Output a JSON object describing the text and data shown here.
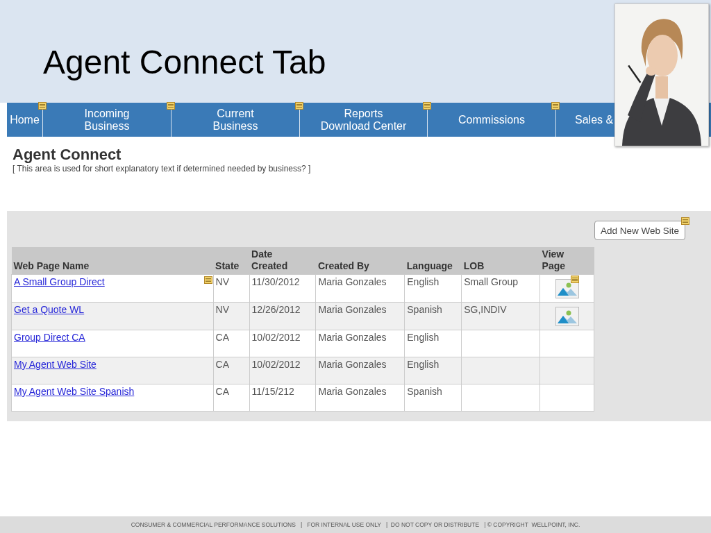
{
  "slide": {
    "title": "Agent Connect Tab"
  },
  "nav": [
    {
      "label": "Home",
      "note": true
    },
    {
      "label": "Incoming\nBusiness",
      "note": true
    },
    {
      "label": "Current\nBusiness",
      "note": true
    },
    {
      "label": "Reports\nDownload Center",
      "note": true
    },
    {
      "label": "Commissions",
      "note": true
    },
    {
      "label": "Sales &",
      "note": false
    }
  ],
  "page": {
    "heading": "Agent Connect",
    "description": "[ This area is used for short explanatory text if determined needed by business? ]"
  },
  "add_button": {
    "label": "Add New Web Site",
    "note": true
  },
  "table": {
    "columns": [
      "Web Page Name",
      "State",
      "Date\nCreated",
      "Created By",
      "Language",
      "LOB",
      "View\nPage"
    ],
    "rows": [
      {
        "name": "A Small Group Direct",
        "name_note": true,
        "state": "NV",
        "date": "11/30/2012",
        "created_by": "Maria Gonzales",
        "language": "English",
        "lob": "Small Group",
        "view_icon": true,
        "view_note": true
      },
      {
        "name": "Get a Quote WL",
        "name_note": false,
        "state": "NV",
        "date": "12/26/2012",
        "created_by": "Maria Gonzales",
        "language": "Spanish",
        "lob": "SG,INDIV",
        "view_icon": true,
        "view_note": false
      },
      {
        "name": "Group Direct CA",
        "name_note": false,
        "state": "CA",
        "date": "10/02/2012",
        "created_by": "Maria Gonzales",
        "language": "English",
        "view_icon": false,
        "view_note": false
      },
      {
        "name": "My Agent Web Site",
        "name_note": false,
        "state": "CA",
        "date": "10/02/2012",
        "created_by": "Maria Gonzales",
        "language": "English",
        "view_icon": false,
        "view_note": false
      },
      {
        "name": "My Agent Web Site Spanish",
        "name_note": false,
        "state": "CA",
        "date": "11/15/212",
        "created_by": "Maria Gonzales",
        "language": "Spanish",
        "view_icon": false,
        "view_note": false
      }
    ]
  },
  "footer": "CONSUMER & COMMERCIAL PERFORMANCE SOLUTIONS   |   FOR INTERNAL USE ONLY   |  DO NOT COPY OR DISTRIBUTE   | © COPYRIGHT  WELLPOINT, INC."
}
